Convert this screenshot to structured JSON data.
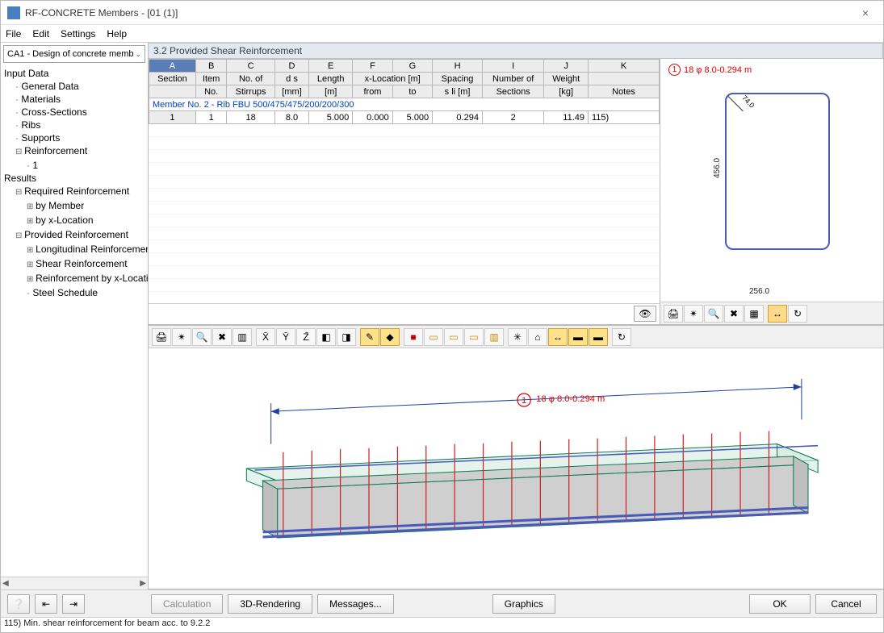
{
  "window": {
    "title": "RF-CONCRETE Members - [01 (1)]"
  },
  "menu": {
    "file": "File",
    "edit": "Edit",
    "settings": "Settings",
    "help": "Help"
  },
  "sidebar": {
    "dropdown": "CA1 - Design of concrete memb",
    "groups": {
      "input": "Input Data",
      "results": "Results"
    },
    "items": {
      "general": "General Data",
      "materials": "Materials",
      "cross": "Cross-Sections",
      "ribs": "Ribs",
      "supports": "Supports",
      "reinf": "Reinforcement",
      "reinf1": "1",
      "reqreinf": "Required Reinforcement",
      "bymember": "by Member",
      "byx": "by x-Location",
      "provreinf": "Provided Reinforcement",
      "long": "Longitudinal Reinforcement",
      "shear": "Shear Reinforcement",
      "rbx": "Reinforcement by x-Location",
      "steel": "Steel Schedule"
    }
  },
  "panel": {
    "title": "3.2  Provided Shear Reinforcement"
  },
  "table": {
    "colhead": {
      "A": "A",
      "B": "B",
      "C": "C",
      "D": "D",
      "E": "E",
      "F": "F",
      "G": "G",
      "H": "H",
      "I": "I",
      "J": "J",
      "K": "K"
    },
    "hdr1": {
      "section": "Section",
      "item": "Item",
      "noof": "No. of",
      "ds": "d s",
      "length": "Length",
      "xloc": "x-Location [m]",
      "spacing": "Spacing",
      "numsec": "Number of",
      "weight": "Weight",
      "notes": ""
    },
    "hdr2": {
      "section": "",
      "no": "No.",
      "stirrups": "Stirrups",
      "mm": "[mm]",
      "m": "[m]",
      "from": "from",
      "to": "to",
      "sli": "s li [m]",
      "sections": "Sections",
      "kg": "[kg]",
      "notes": "Notes"
    },
    "memberrow": "Member No. 2  -  Rib FBU 500/475/475/200/200/300",
    "row": {
      "section": "1",
      "item": "1",
      "stirrups": "18",
      "ds": "8.0",
      "length": "5.000",
      "from": "0.000",
      "to": "5.000",
      "spacing": "0.294",
      "numsec": "2",
      "weight": "11.49",
      "notes": "115)"
    }
  },
  "xsection": {
    "label": "18 φ 8.0-0.294 m",
    "tag": "1",
    "dim_w": "256.0",
    "dim_h": "456.0",
    "corner": "74.0"
  },
  "view3d": {
    "label": "18 φ 8.0-0.294 m",
    "tag": "1"
  },
  "buttons": {
    "calc": "Calculation",
    "render": "3D-Rendering",
    "messages": "Messages...",
    "graphics": "Graphics",
    "ok": "OK",
    "cancel": "Cancel"
  },
  "status": "115) Min. shear reinforcement for beam acc. to 9.2.2"
}
